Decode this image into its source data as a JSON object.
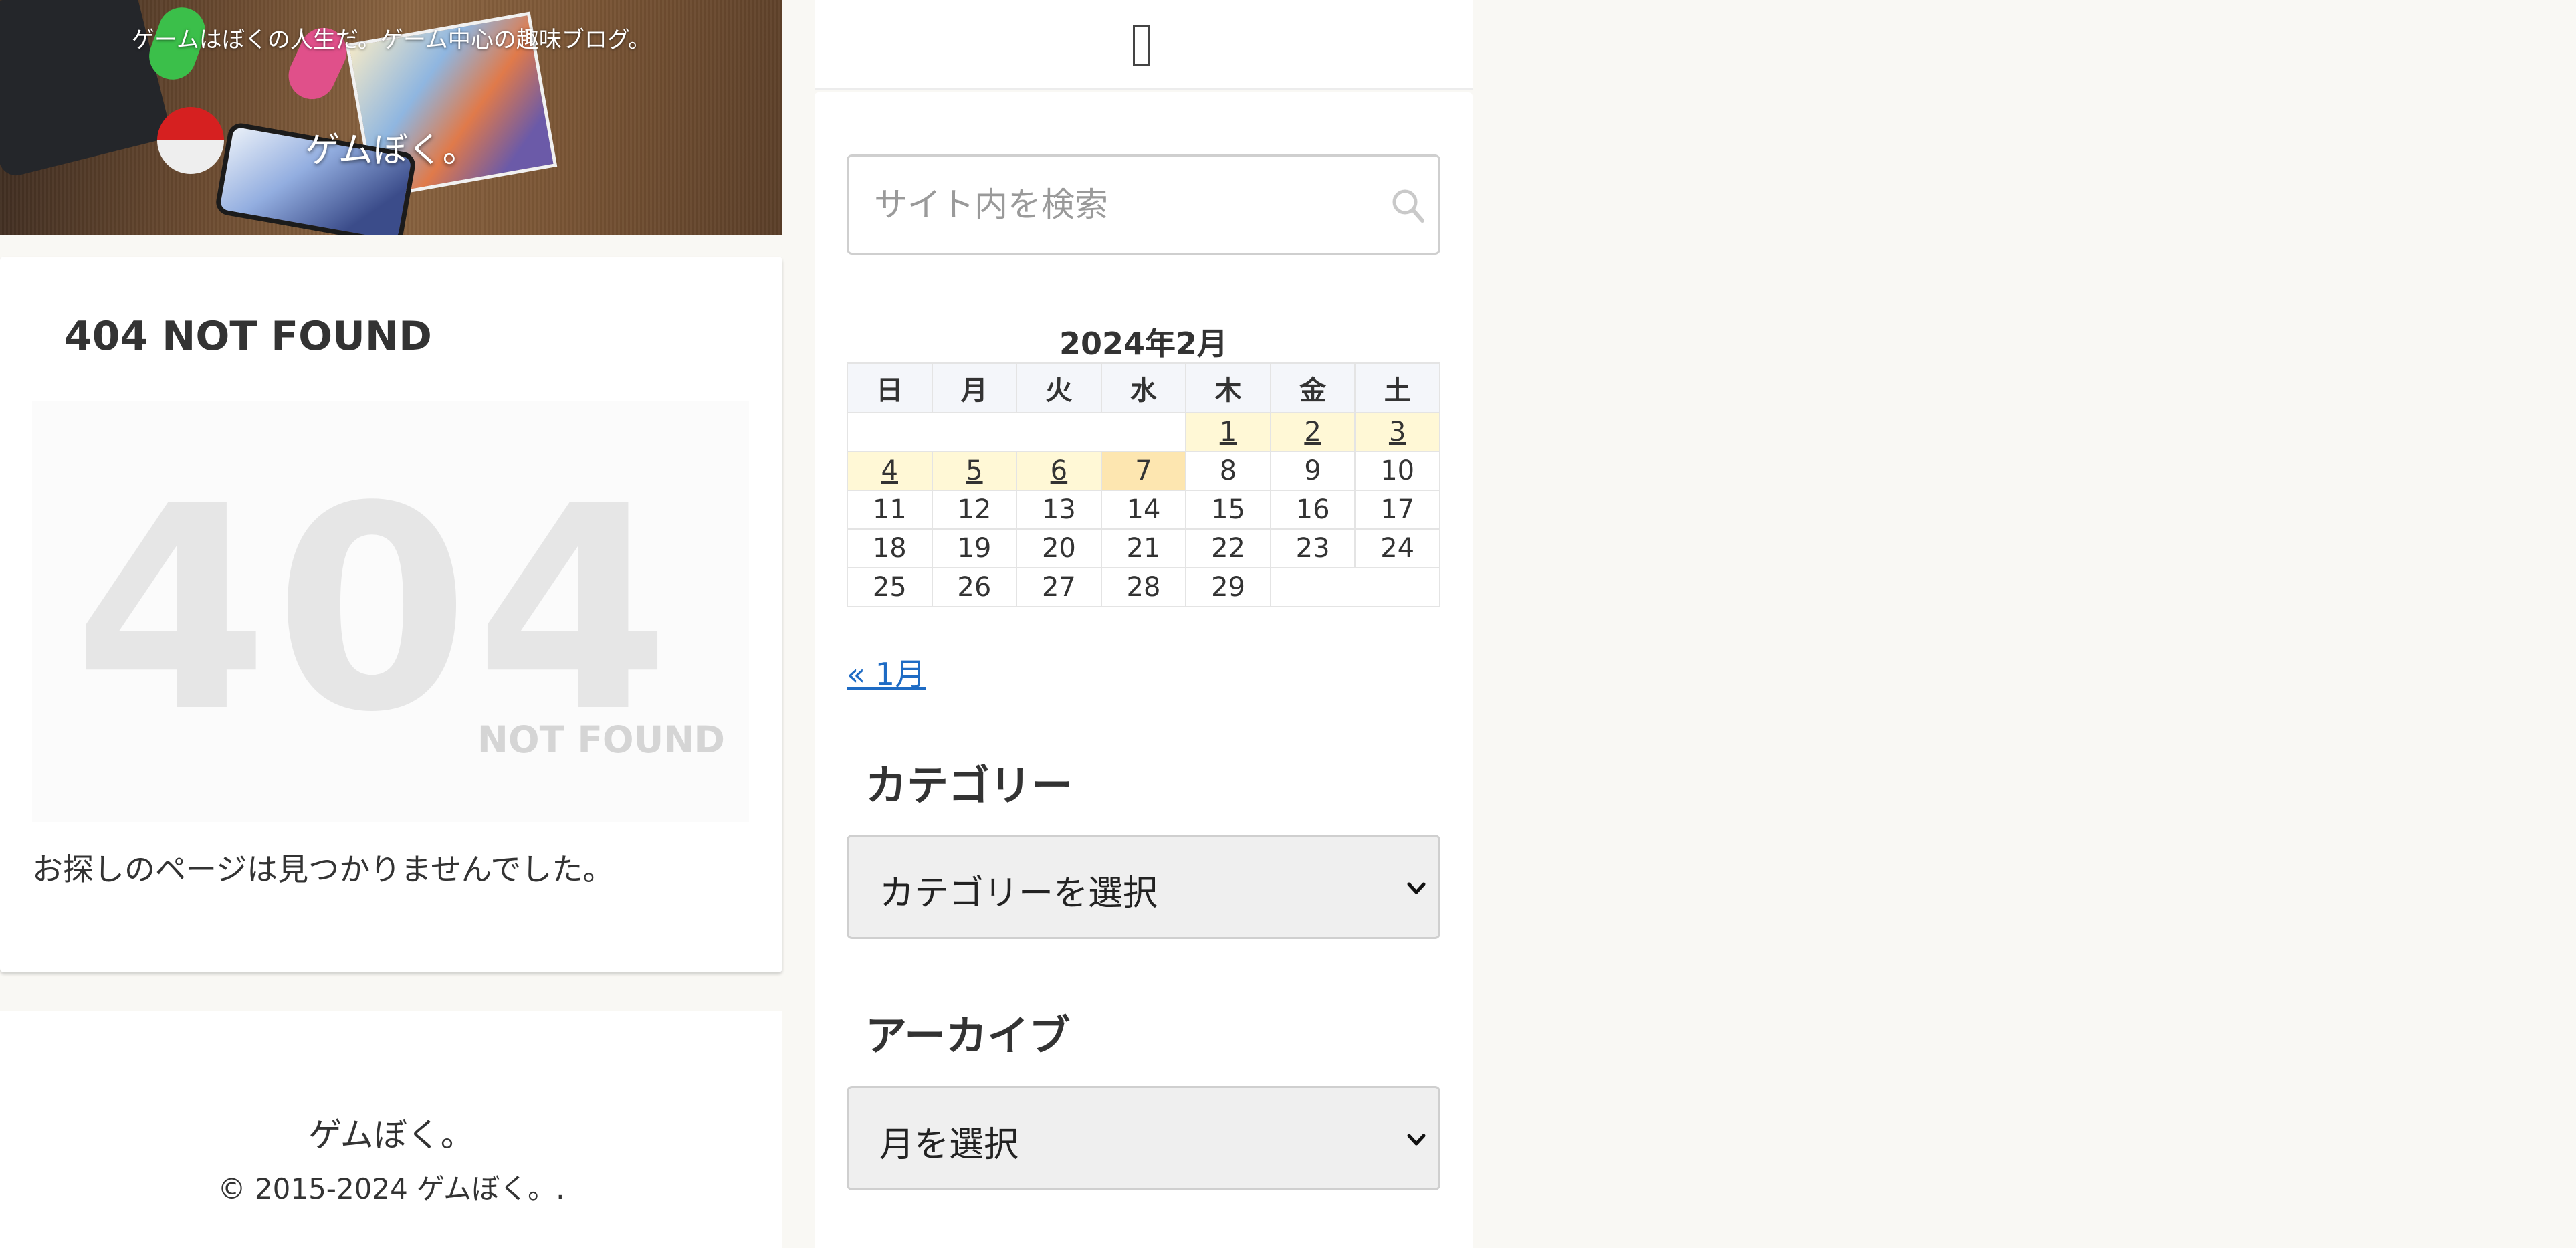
{
  "header": {
    "tagline": "ゲームはぼくの人生だ。ゲーム中心の趣味ブログ。",
    "site_name": "ゲムぼく。"
  },
  "main": {
    "title": "404 NOT FOUND",
    "big_number": "404",
    "not_found_label": "NOT FOUND",
    "message": "お探しのページは見つかりませんでした。"
  },
  "footer": {
    "site_name": "ゲムぼく。",
    "copyright": "© 2015-2024 ゲムぼく。."
  },
  "sidebar": {
    "menu_icon": "menu-icon",
    "search": {
      "placeholder": "サイト内を検索",
      "value": "",
      "icon": "search-icon"
    },
    "calendar": {
      "caption": "2024年2月",
      "weekdays": [
        "日",
        "月",
        "火",
        "水",
        "木",
        "金",
        "土"
      ],
      "days": {
        "d1": "1",
        "d2": "2",
        "d3": "3",
        "d4": "4",
        "d5": "5",
        "d6": "6",
        "d7": "7",
        "d8": "8",
        "d9": "9",
        "d10": "10",
        "d11": "11",
        "d12": "12",
        "d13": "13",
        "d14": "14",
        "d15": "15",
        "d16": "16",
        "d17": "17",
        "d18": "18",
        "d19": "19",
        "d20": "20",
        "d21": "21",
        "d22": "22",
        "d23": "23",
        "d24": "24",
        "d25": "25",
        "d26": "26",
        "d27": "27",
        "d28": "28",
        "d29": "29"
      },
      "prev_link": "« 1月"
    },
    "categories": {
      "title": "カテゴリー",
      "selected": "カテゴリーを選択"
    },
    "archives": {
      "title": "アーカイブ",
      "selected": "月を選択"
    }
  },
  "colors": {
    "page_background": "#f9f8f4",
    "link": "#1e6bc4",
    "calendar_post_day": "#fff8d6",
    "calendar_today": "#fde6b0"
  }
}
